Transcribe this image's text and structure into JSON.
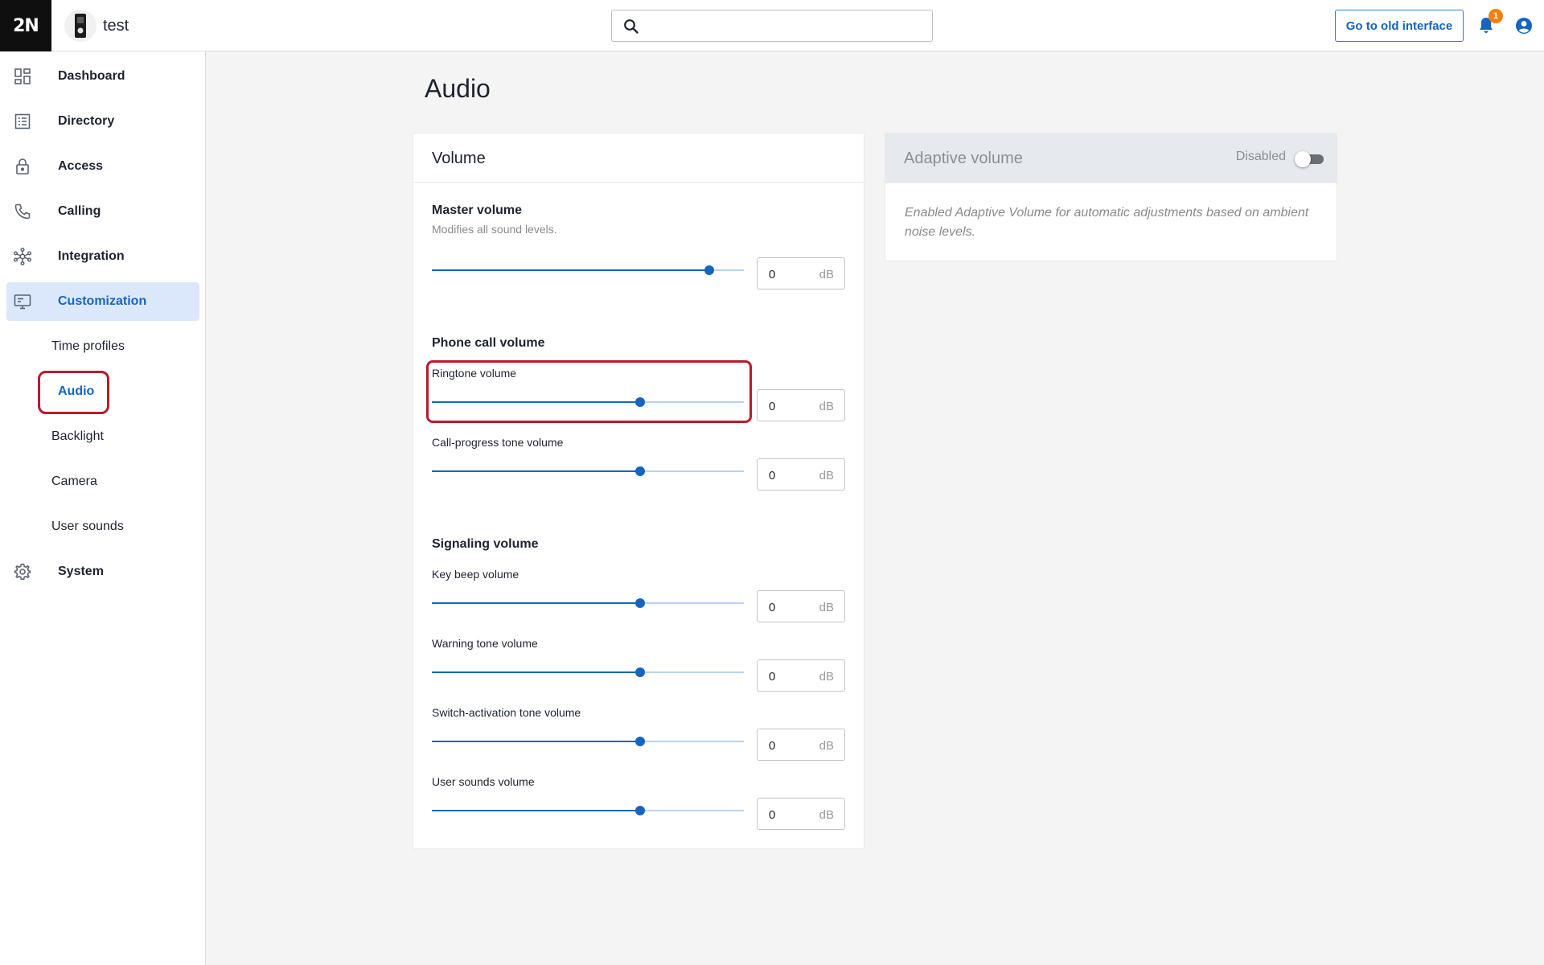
{
  "header": {
    "logo": "2N",
    "device_name": "test",
    "search_placeholder": "",
    "old_interface_label": "Go to old interface",
    "notification_count": "1"
  },
  "sidebar": {
    "items": [
      {
        "label": "Dashboard",
        "icon": "dashboard-icon"
      },
      {
        "label": "Directory",
        "icon": "directory-icon"
      },
      {
        "label": "Access",
        "icon": "lock-icon"
      },
      {
        "label": "Calling",
        "icon": "phone-icon"
      },
      {
        "label": "Integration",
        "icon": "integration-icon"
      },
      {
        "label": "Customization",
        "icon": "monitor-icon",
        "active": true
      },
      {
        "label": "System",
        "icon": "gear-icon"
      }
    ],
    "sub_items": [
      {
        "label": "Time profiles"
      },
      {
        "label": "Audio",
        "active": true
      },
      {
        "label": "Backlight"
      },
      {
        "label": "Camera"
      },
      {
        "label": "User sounds"
      }
    ]
  },
  "page": {
    "title": "Audio"
  },
  "volume": {
    "title": "Volume",
    "master": {
      "title": "Master volume",
      "hint": "Modifies all sound levels.",
      "level": 0.89,
      "value": "0",
      "unit": "dB"
    },
    "phone_title": "Phone call volume",
    "ringtone": {
      "label": "Ringtone volume",
      "level": 0.667,
      "value": "0",
      "unit": "dB"
    },
    "call_progress": {
      "label": "Call-progress tone volume",
      "level": 0.667,
      "value": "0",
      "unit": "dB"
    },
    "signaling_title": "Signaling volume",
    "key_beep": {
      "label": "Key beep volume",
      "level": 0.667,
      "value": "0",
      "unit": "dB"
    },
    "warning": {
      "label": "Warning tone volume",
      "level": 0.667,
      "value": "0",
      "unit": "dB"
    },
    "switch_activation": {
      "label": "Switch-activation tone volume",
      "level": 0.667,
      "value": "0",
      "unit": "dB"
    },
    "user_sounds": {
      "label": "User sounds volume",
      "level": 0.667,
      "value": "0",
      "unit": "dB"
    }
  },
  "adaptive": {
    "title": "Adaptive volume",
    "state": "Disabled",
    "enabled": false,
    "description": "Enabled Adaptive Volume for automatic adjustments based on ambient noise levels."
  },
  "colors": {
    "accent": "#1565c0",
    "highlight": "#b81c2c",
    "badge": "#f08010"
  }
}
